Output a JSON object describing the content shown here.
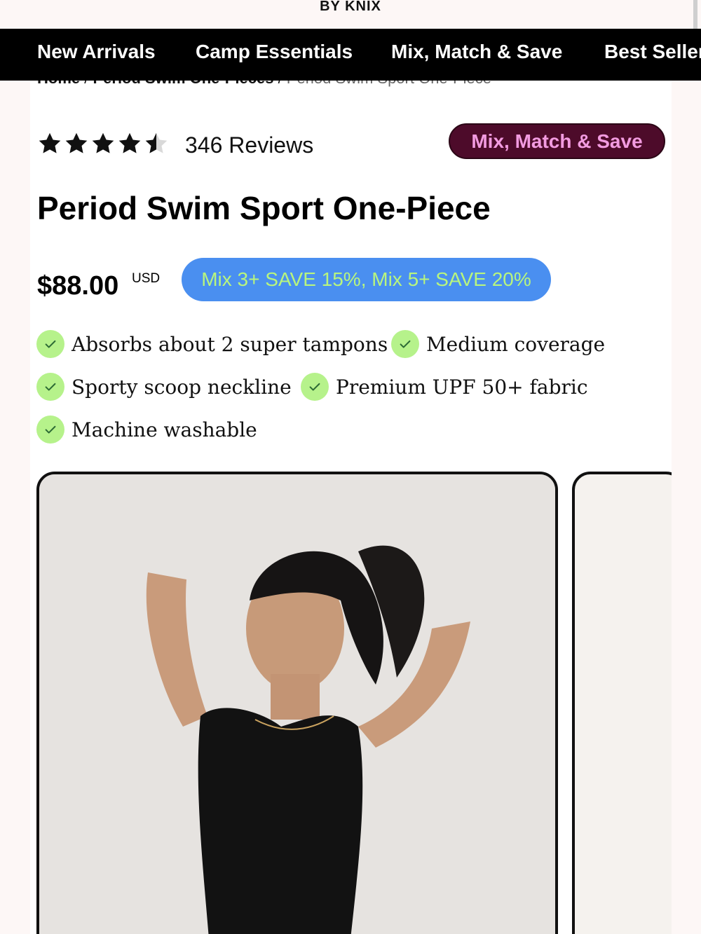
{
  "brand": "BY KNIX",
  "nav": [
    "New Arrivals",
    "Camp Essentials",
    "Mix, Match & Save",
    "Best Sellers"
  ],
  "breadcrumb": {
    "home": "Home",
    "collection": "Period Swim One-Pieces",
    "current": "Period Swim Sport One-Piece"
  },
  "rating": {
    "stars": 4.5,
    "reviews_label": "346 Reviews"
  },
  "promo_badge": "Mix, Match & Save",
  "product": {
    "title": "Period Swim Sport One-Piece",
    "price": "$88.00",
    "currency": "USD",
    "discount": "Mix 3+ SAVE 15%, Mix 5+ SAVE 20%"
  },
  "features": [
    "Absorbs about 2 super tampons",
    "Medium coverage",
    "Sporty scoop neckline",
    "Premium UPF 50+ fabric",
    "Machine washable"
  ],
  "colors": {
    "nav_bg": "#000000",
    "promo_bg": "#4d0b2a",
    "promo_text": "#f29be0",
    "discount_bg": "#4a8ff0",
    "discount_text": "#b8f57e",
    "check_bg": "#b6f28b"
  }
}
